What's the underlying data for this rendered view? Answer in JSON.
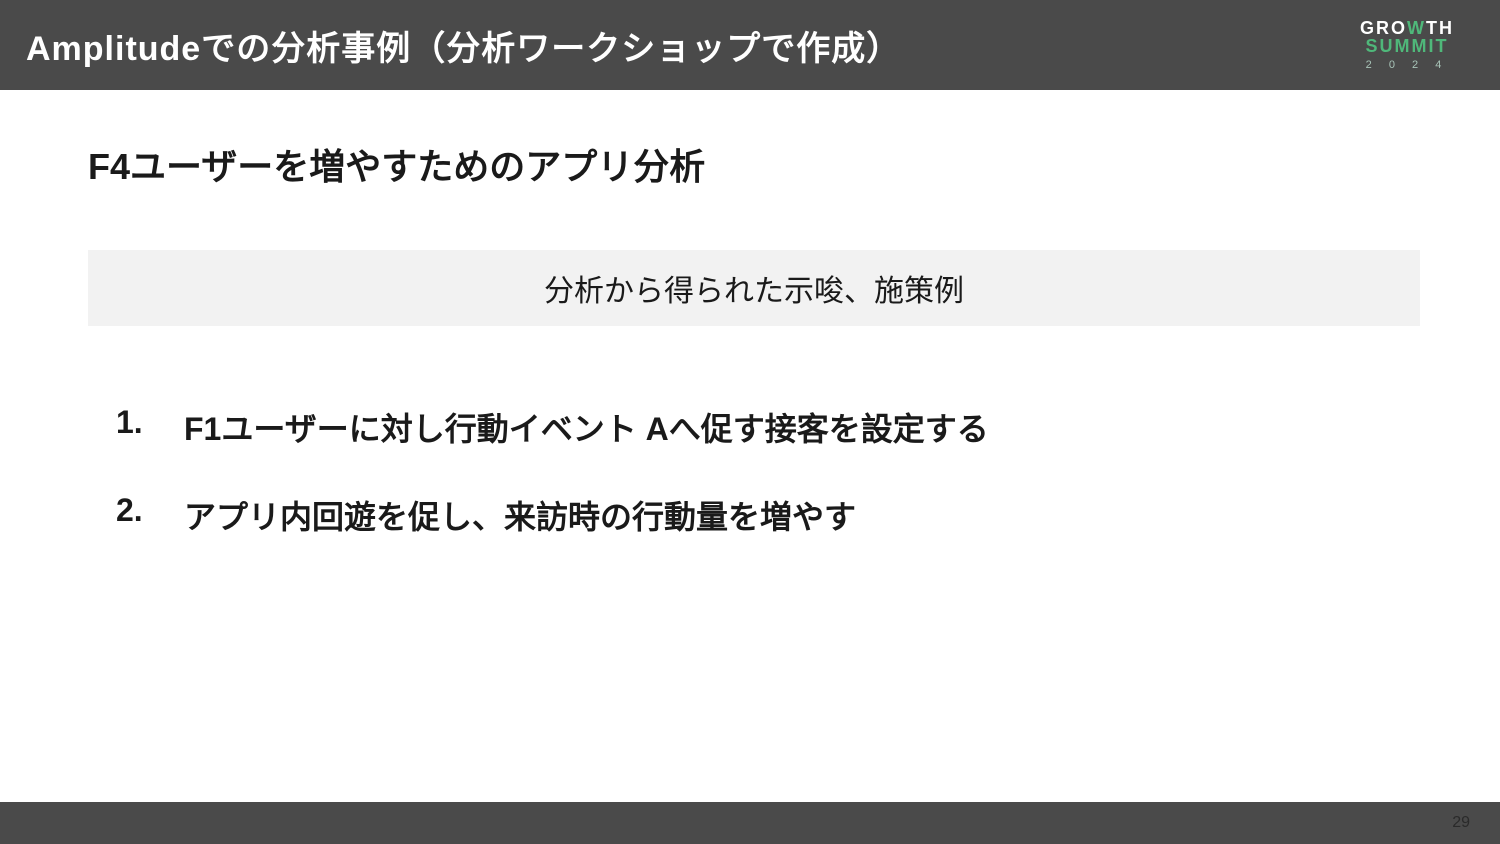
{
  "header": {
    "title": "Amplitudeでの分析事例（分析ワークショップで作成）",
    "logo": {
      "line1_pre": "GRO",
      "line1_v": "W",
      "line1_post": "TH",
      "line2": "SUMMIT",
      "year": "2 0 2 4"
    }
  },
  "content": {
    "subtitle": "F4ユーザーを増やすためのアプリ分析",
    "insight_heading": "分析から得られた示唆、施策例",
    "items": [
      {
        "number": "1.",
        "text": "F1ユーザーに対し行動イベント Aへ促す接客を設定する"
      },
      {
        "number": "2.",
        "text": "アプリ内回遊を促し、来訪時の行動量を増やす"
      }
    ]
  },
  "footer": {
    "page_number": "29"
  }
}
